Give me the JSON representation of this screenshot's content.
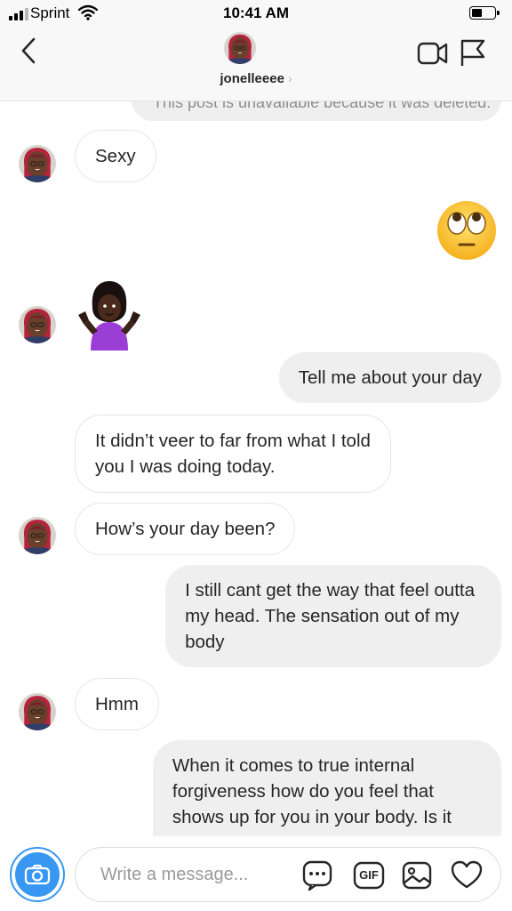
{
  "status_bar": {
    "carrier": "Sprint",
    "time": "10:41 AM",
    "battery_level": 0.4
  },
  "header": {
    "username": "jonelleeee",
    "chevron": "›"
  },
  "messages": {
    "partial_text": "This post is unavailable because it was deleted.",
    "m1": "Sexy",
    "m2_emoji": "face-with-rolling-eyes",
    "m3_emoji": "person-shrugging",
    "m4": "Tell me about your day",
    "m5_line1": "It didn’t veer to far from what I told",
    "m5_line2": "you I was doing today.",
    "m6": "How’s your day been?",
    "m7_line1": "I still cant get the way that feel outta",
    "m7_line2": "my head. The sensation out of my",
    "m7_line3": "body",
    "m8": "Hmm",
    "m9_line1": "When it comes to true internal",
    "m9_line2": "forgiveness how do you feel that",
    "m9_line3": "shows up for you in your body. Is it"
  },
  "composer": {
    "placeholder": "Write a message...",
    "gif_label": "GIF",
    "icons": [
      "camera-icon",
      "sticker-chat-icon",
      "gif-icon",
      "photo-icon",
      "heart-icon"
    ]
  },
  "colors": {
    "accent": "#3897f0",
    "bubble_out": "#efefef",
    "bubble_in_border": "#e6e6e6"
  }
}
